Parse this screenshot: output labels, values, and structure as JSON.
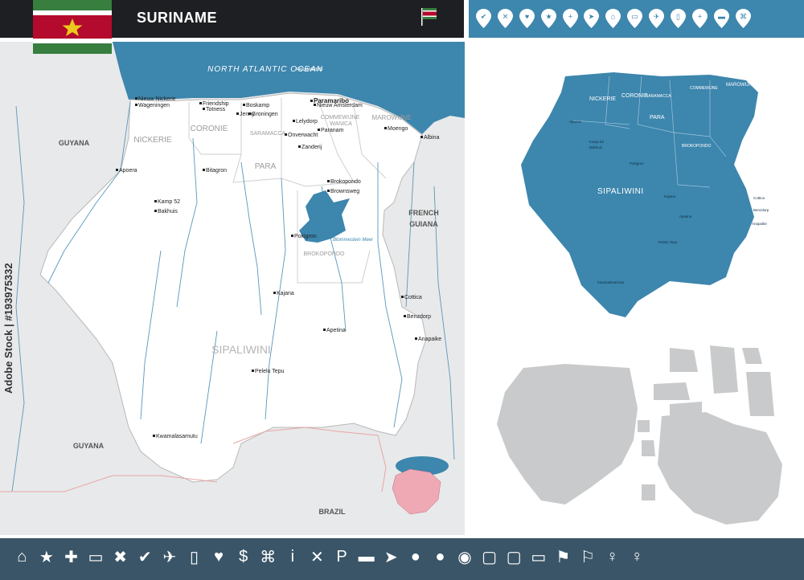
{
  "header": {
    "title": "SURINAME",
    "flag_colors": {
      "green": "#377e3f",
      "white": "#ffffff",
      "red": "#b40a2d",
      "star": "#ecc81d"
    },
    "pin_icons": [
      "check-icon",
      "close-icon",
      "heart-icon",
      "star-icon",
      "plus-icon",
      "navigation-icon",
      "home-icon",
      "car-icon",
      "airplane-icon",
      "fuel-icon",
      "plus-icon",
      "bed-icon",
      "command-icon"
    ]
  },
  "main_map": {
    "ocean_label": "NORTH ATLANTIC OCEAN",
    "neighbors": [
      "GUYANA",
      "GUYANA",
      "FRENCH",
      "GUIANA",
      "BRAZIL"
    ],
    "districts": [
      "NICKERIE",
      "CORONIE",
      "SARAMACCA",
      "PARA",
      "COMMEWIJNE",
      "MAROWIJNE",
      "BROKOPONDO",
      "SIPALIWINI",
      "PARAMARIBO",
      "WANICA"
    ],
    "cities": [
      "Nieuw Nickerie",
      "Wageningen",
      "Friendship",
      "Totness",
      "Jenny",
      "Boskamp",
      "Groningen",
      "Paramaribo",
      "Nieuw Amsterdam",
      "Lelydorp",
      "Onverwacht",
      "Paranam",
      "Zanderij",
      "Moengo",
      "Albina",
      "Apoera",
      "Bitagron",
      "Kamp 52",
      "Bakhuis",
      "Brokopondo",
      "Brownsweg",
      "Pokigron",
      "Kajana",
      "Cottica",
      "Benzdorp",
      "Apetina",
      "Anapaike",
      "Pelelu Tepu",
      "Kwamalasamutu"
    ],
    "lake_label": "Blommestein Meer",
    "colors": {
      "land": "#ffffff",
      "neighbor": "#e8e9ea",
      "water": "#3d86ad",
      "river": "#5a97ba",
      "border": "#c8c8c8",
      "inset": "#eea9b4"
    }
  },
  "mini_map": {
    "label": "SIPALIWINI",
    "districts": [
      "NICKERIE",
      "CORONIE",
      "PARA",
      "SARAMACCA",
      "COMMEWIJNE",
      "MAROWIJNE",
      "BROKOPONDO"
    ],
    "cities": [
      "Apoera",
      "Kamp 52",
      "Bakhuis",
      "Pokigron",
      "Kajana",
      "Cottica",
      "Benzdorp",
      "Apetina",
      "Anapaike",
      "Pelelu Tepu",
      "Kwamalasamutu"
    ],
    "color": "#3d86ad"
  },
  "gray_map": {
    "color": "#c9cacb"
  },
  "toolbar": {
    "icons": [
      {
        "name": "home-icon",
        "glyph": "⌂"
      },
      {
        "name": "star-icon",
        "glyph": "★"
      },
      {
        "name": "plus-icon",
        "glyph": "✚"
      },
      {
        "name": "car-icon",
        "glyph": "▭"
      },
      {
        "name": "close-icon",
        "glyph": "✖"
      },
      {
        "name": "check-icon",
        "glyph": "✔"
      },
      {
        "name": "airplane-icon",
        "glyph": "✈"
      },
      {
        "name": "fuel-icon",
        "glyph": "▯"
      },
      {
        "name": "heart-icon",
        "glyph": "♥"
      },
      {
        "name": "dollar-icon",
        "glyph": "$"
      },
      {
        "name": "command-icon",
        "glyph": "⌘"
      },
      {
        "name": "info-icon",
        "glyph": "i"
      },
      {
        "name": "restaurant-icon",
        "glyph": "✕"
      },
      {
        "name": "parking-icon",
        "glyph": "P"
      },
      {
        "name": "bed-icon",
        "glyph": "▬"
      },
      {
        "name": "navigation-icon",
        "glyph": "➤"
      },
      {
        "name": "map-pin-icon",
        "glyph": "●"
      },
      {
        "name": "map-pin-icon",
        "glyph": "●"
      },
      {
        "name": "map-pin-icon",
        "glyph": "◉"
      },
      {
        "name": "speech-bubble-icon",
        "glyph": "▢"
      },
      {
        "name": "speech-bubble-icon",
        "glyph": "▢"
      },
      {
        "name": "speech-bubble-icon",
        "glyph": "▭"
      },
      {
        "name": "flag-icon",
        "glyph": "⚑"
      },
      {
        "name": "flag-icon",
        "glyph": "⚐"
      },
      {
        "name": "pin-icon",
        "glyph": "♀"
      },
      {
        "name": "pin-icon",
        "glyph": "♀"
      }
    ]
  },
  "watermark": "Adobe Stock | #193975332"
}
